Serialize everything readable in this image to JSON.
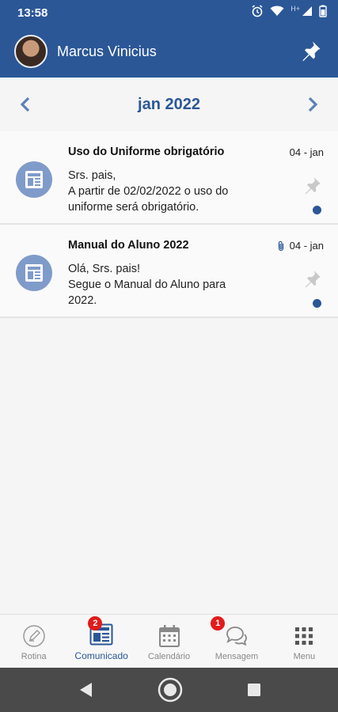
{
  "status_bar": {
    "time": "13:58",
    "network_label": "H+",
    "icons": [
      "alarm-icon",
      "wifi-icon",
      "signal-icon",
      "battery-icon"
    ]
  },
  "header": {
    "user_name": "Marcus Vinicius",
    "pin_icon": "pin-icon"
  },
  "month_nav": {
    "title": "jan 2022"
  },
  "notices": [
    {
      "title": "Uso do Uniforme obrigatório",
      "date": "04 - jan",
      "body": [
        "Srs. pais,",
        "A partir de 02/02/2022 o uso do",
        "uniforme será obrigatório."
      ],
      "has_attachment": false,
      "unread": true
    },
    {
      "title": "Manual do Aluno 2022",
      "date": "04 - jan",
      "body": [
        "Olá, Srs. pais!",
        "Segue o Manual do Aluno para",
        "2022."
      ],
      "has_attachment": true,
      "unread": true
    }
  ],
  "bottom_nav": {
    "items": [
      {
        "label": "Rotina",
        "icon": "pencil-circle-icon",
        "badge": ""
      },
      {
        "label": "Comunicado",
        "icon": "newspaper-icon",
        "badge": "2"
      },
      {
        "label": "Calendário",
        "icon": "calendar-icon",
        "badge": ""
      },
      {
        "label": "Mensagem",
        "icon": "chat-icon",
        "badge": "1"
      },
      {
        "label": "Menu",
        "icon": "grid-icon",
        "badge": ""
      }
    ],
    "active_index": 1
  },
  "colors": {
    "primary": "#2b5797",
    "badge": "#e21b1b",
    "notice_icon_bg": "#7f9bc9"
  }
}
